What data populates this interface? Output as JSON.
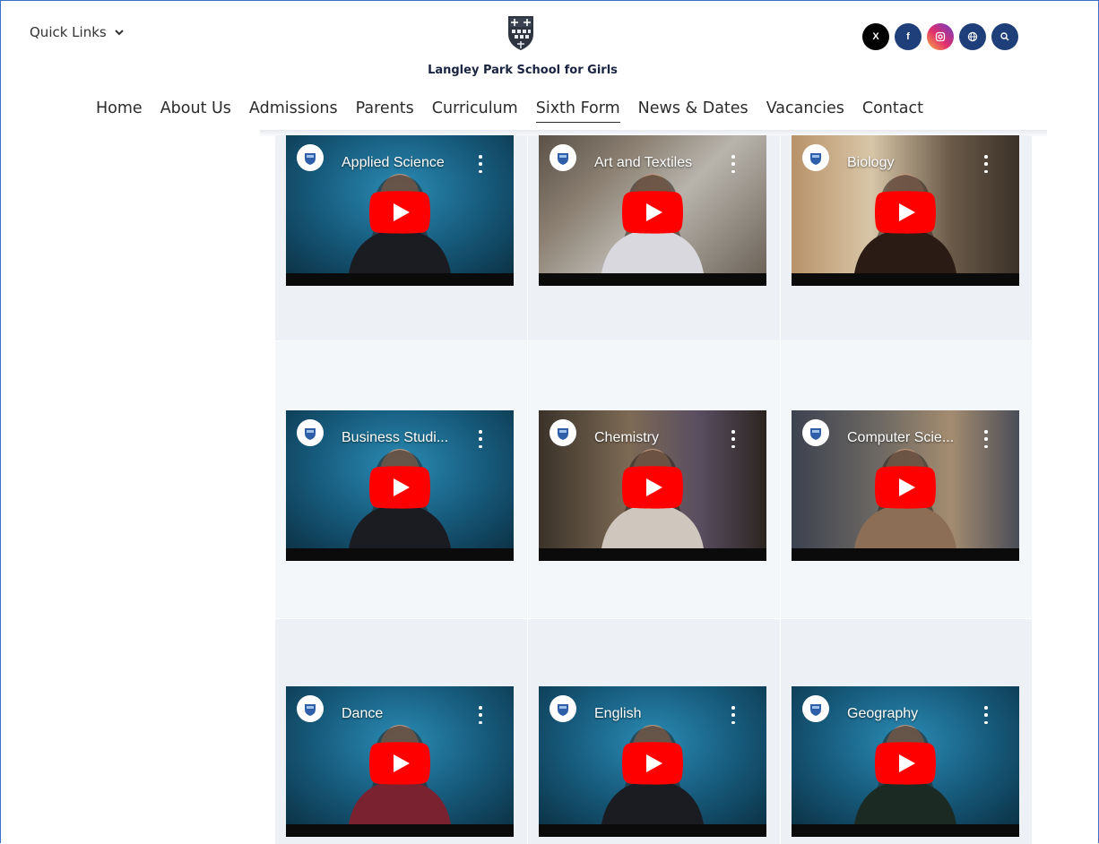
{
  "header": {
    "quick_links": "Quick Links",
    "school_name": "Langley Park School for Girls",
    "social_icons": [
      "x-icon",
      "facebook-icon",
      "instagram-icon",
      "globe-icon",
      "search-icon"
    ],
    "social_x_label": "X",
    "social_fb_label": "f"
  },
  "nav": {
    "items": [
      "Home",
      "About Us",
      "Admissions",
      "Parents",
      "Curriculum",
      "Sixth Form",
      "News & Dates",
      "Vacancies",
      "Contact"
    ],
    "active": "Sixth Form"
  },
  "videos": [
    {
      "title": "Applied Science"
    },
    {
      "title": "Art and Textiles"
    },
    {
      "title": "Biology"
    },
    {
      "title": "Business Studi..."
    },
    {
      "title": "Chemistry"
    },
    {
      "title": "Computer Scie..."
    },
    {
      "title": "Dance"
    },
    {
      "title": "English"
    },
    {
      "title": "Geography"
    }
  ],
  "colors": {
    "nav_text": "#2b2b2b",
    "brand_navy": "#1f3f7a",
    "youtube_red": "#ff0000",
    "frame_border": "#3a6fc9"
  }
}
